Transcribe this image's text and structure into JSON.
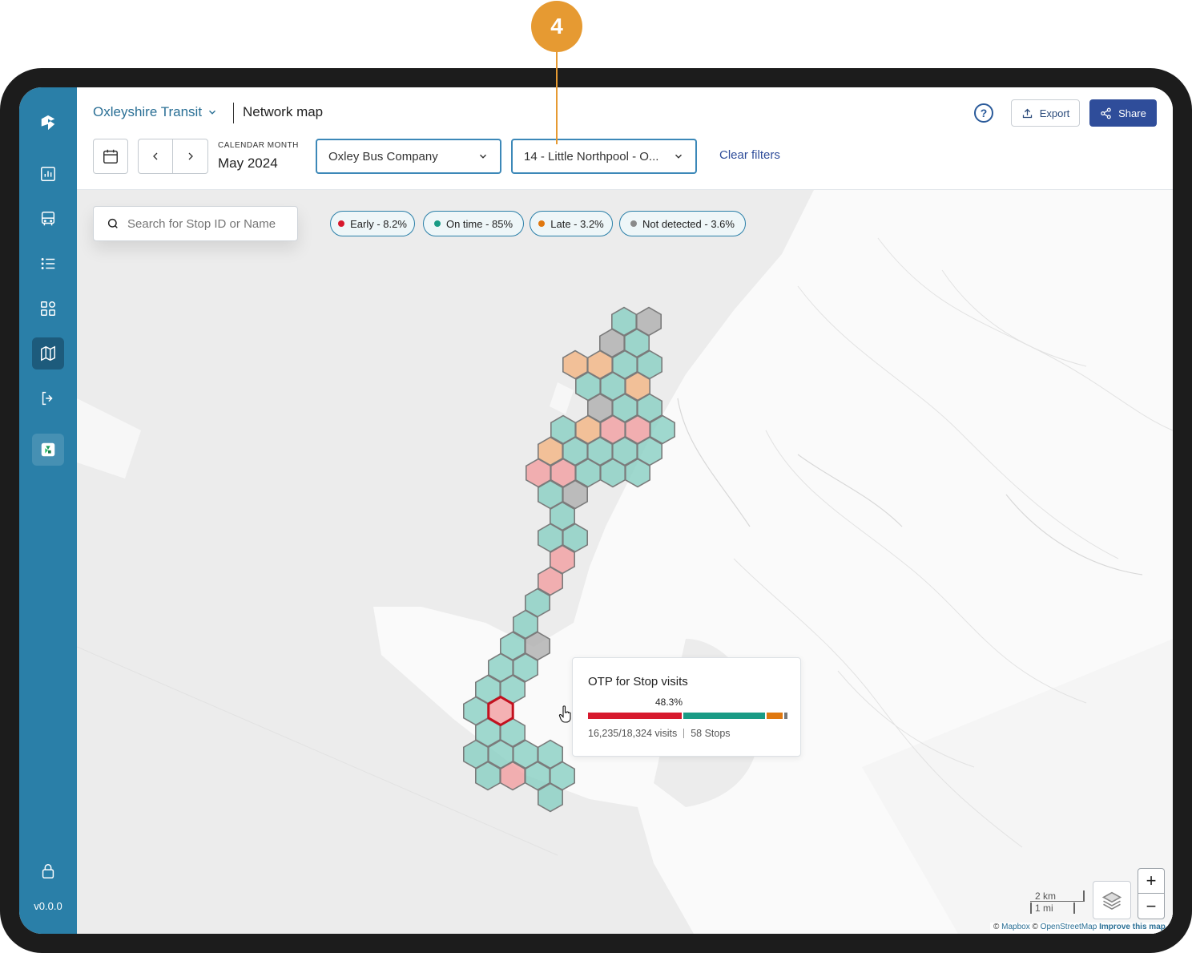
{
  "callout": {
    "number": "4"
  },
  "header": {
    "org_name": "Oxleyshire Transit",
    "page_title": "Network map",
    "help": "?",
    "export_label": "Export",
    "share_label": "Share"
  },
  "filters": {
    "calendar_label": "CALENDAR MONTH",
    "calendar_value": "May 2024",
    "operator": "Oxley Bus Company",
    "route": "14 - Little Northpool - O...",
    "clear_label": "Clear filters"
  },
  "search": {
    "placeholder": "Search for Stop ID or Name"
  },
  "legend": [
    {
      "label": "Early - 8.2%",
      "color": "#d7192d"
    },
    {
      "label": "On time - 85%",
      "color": "#1a9b85"
    },
    {
      "label": "Late - 3.2%",
      "color": "#e0780f"
    },
    {
      "label": "Not detected - 3.6%",
      "color": "#8a8a8a"
    }
  ],
  "tooltip": {
    "title": "OTP for Stop visits",
    "percent": "48.3%",
    "visits": "16,235/18,324 visits",
    "stops": "58 Stops",
    "bar": [
      {
        "label": "Early",
        "value": 48.3,
        "color": "#d7192d"
      },
      {
        "label": "On time",
        "value": 42.0,
        "color": "#1a9b85"
      },
      {
        "label": "Late",
        "value": 7.9,
        "color": "#e0780f"
      },
      {
        "label": "Not detected",
        "value": 1.8,
        "color": "#777777"
      }
    ]
  },
  "map_controls": {
    "scale_km": "2 km",
    "scale_mi": "1 mi",
    "zoom_in": "+",
    "zoom_out": "−"
  },
  "attribution": {
    "c1": "©",
    "mapbox": "Mapbox",
    "c2": "©",
    "osm": "OpenStreetMap",
    "improve": "Improve this map"
  },
  "sidebar": {
    "items": [
      "logo-icon",
      "dashboard-icon",
      "bus-icon",
      "list-icon",
      "apps-icon",
      "map-icon",
      "logout-icon",
      "app-icon"
    ],
    "version": "v0.0.0"
  },
  "hex_colors": {
    "teal": "#8ed1c6",
    "orange": "#f3b98a",
    "red": "#f2a3a6",
    "grey": "#b3b3b3"
  }
}
